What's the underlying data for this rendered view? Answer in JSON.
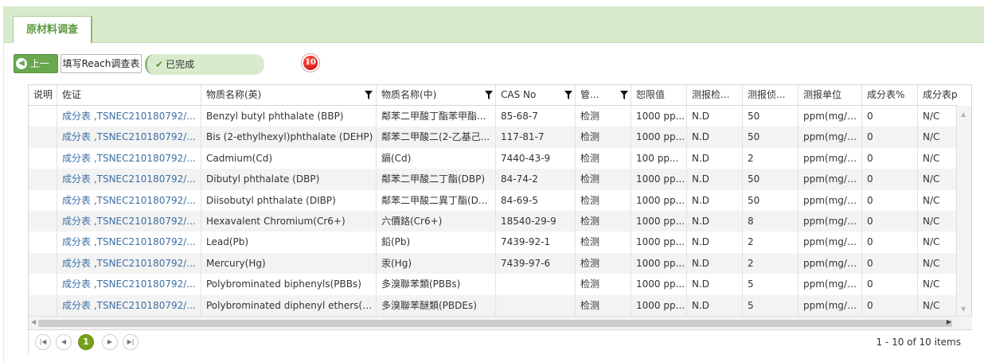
{
  "tab": {
    "label": "原材料调查"
  },
  "toolbar": {
    "prev_label": "上一步",
    "fill_label": "填写Reach调查表",
    "status_label": "已完成"
  },
  "badge": {
    "value": "10"
  },
  "columns": [
    "说明",
    "佐证",
    "物质名称(英)",
    "物质名称(中)",
    "CAS No",
    "管...",
    "恕限值",
    "测报检...",
    "测报侦...",
    "测报单位",
    "成分表%",
    "成分表p"
  ],
  "rows": [
    [
      "",
      "成分表 ,TSNEC210180792/...",
      "Benzyl butyl phthalate (BBP)",
      "鄰苯二甲酸丁酯苯甲酯...",
      "85-68-7",
      "检测",
      "1000 pp...",
      "N.D",
      "50",
      "ppm(mg/kg)",
      "0",
      "N/C"
    ],
    [
      "",
      "成分表 ,TSNEC210180792/...",
      "Bis (2-ethylhexyl)phthalate (DEHP)",
      "鄰苯二甲酸二(2-乙基己...",
      "117-81-7",
      "检测",
      "1000 pp...",
      "N.D",
      "50",
      "ppm(mg/kg)",
      "0",
      "N/C"
    ],
    [
      "",
      "成分表 ,TSNEC210180792/...",
      "Cadmium(Cd)",
      "鎘(Cd)",
      "7440-43-9",
      "检测",
      "100 pp...",
      "N.D",
      "2",
      "ppm(mg/kg)",
      "0",
      "N/C"
    ],
    [
      "",
      "成分表 ,TSNEC210180792/...",
      "Dibutyl phthalate (DBP)",
      "鄰苯二甲酸二丁酯(DBP)",
      "84-74-2",
      "检测",
      "1000 pp...",
      "N.D",
      "50",
      "ppm(mg/kg)",
      "0",
      "N/C"
    ],
    [
      "",
      "成分表 ,TSNEC210180792/...",
      "Diisobutyl phthalate (DIBP)",
      "鄰苯二甲酸二異丁酯(D...",
      "84-69-5",
      "检测",
      "1000 pp...",
      "N.D",
      "50",
      "ppm(mg/kg)",
      "0",
      "N/C"
    ],
    [
      "",
      "成分表 ,TSNEC210180792/...",
      "Hexavalent Chromium(Cr6+)",
      "六價鉻(Cr6+)",
      "18540-29-9",
      "检测",
      "1000 pp...",
      "N.D",
      "8",
      "ppm(mg/kg)",
      "0",
      "N/C"
    ],
    [
      "",
      "成分表 ,TSNEC210180792/...",
      "Lead(Pb)",
      "鉛(Pb)",
      "7439-92-1",
      "检测",
      "1000 pp...",
      "N.D",
      "2",
      "ppm(mg/kg)",
      "0",
      "N/C"
    ],
    [
      "",
      "成分表 ,TSNEC210180792/...",
      "Mercury(Hg)",
      "汞(Hg)",
      "7439-97-6",
      "检测",
      "1000 pp...",
      "N.D",
      "2",
      "ppm(mg/kg)",
      "0",
      "N/C"
    ],
    [
      "",
      "成分表 ,TSNEC210180792/...",
      "Polybrominated biphenyls(PBBs)",
      "多溴聯苯類(PBBs)",
      "",
      "检测",
      "1000 pp...",
      "N.D",
      "5",
      "ppm(mg/kg)",
      "0",
      "N/C"
    ],
    [
      "",
      "成分表 ,TSNEC210180792/...",
      "Polybrominated diphenyl ethers(PB...",
      "多溴聯苯醚類(PBDEs)",
      "",
      "检测",
      "1000 pp...",
      "N.D",
      "5",
      "ppm(mg/kg)",
      "0",
      "N/C"
    ]
  ],
  "pager": {
    "current_page": "1",
    "info": "1 - 10 of 10 items"
  }
}
